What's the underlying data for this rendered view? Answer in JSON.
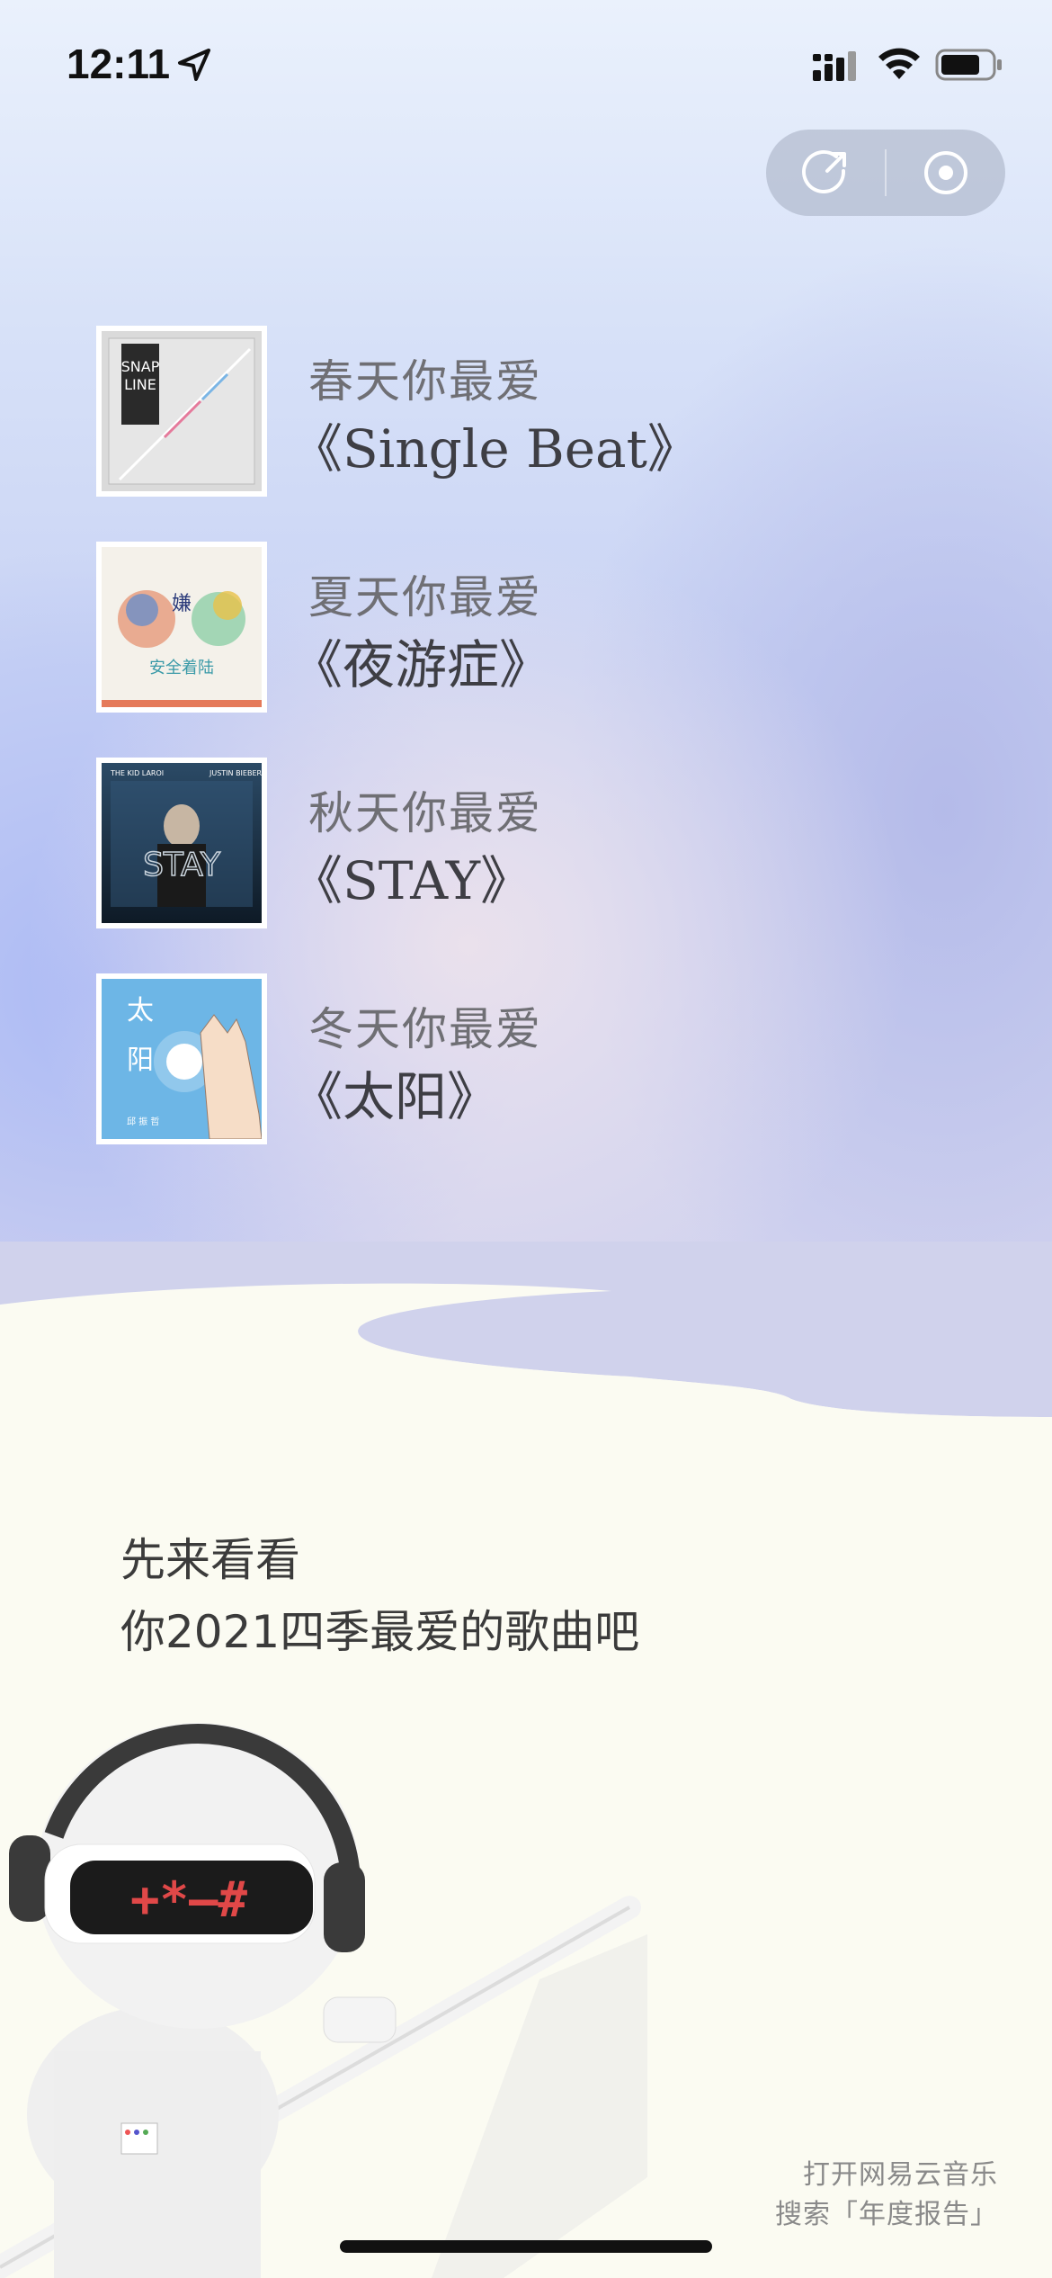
{
  "status_bar": {
    "time": "12:11"
  },
  "songs": [
    {
      "season": "春天你最爱",
      "title": "《Single Beat》",
      "cover": "snap-line-album-cover"
    },
    {
      "season": "夏天你最爱",
      "title": "《夜游症》",
      "cover": "anquan-album-cover"
    },
    {
      "season": "秋天你最爱",
      "title": "《STAY》",
      "cover": "stay-album-cover"
    },
    {
      "season": "冬天你最爱",
      "title": "《太阳》",
      "cover": "taiyang-album-cover"
    }
  ],
  "intro": {
    "line1": "先来看看",
    "line2": "你2021四季最爱的歌曲吧"
  },
  "footer": {
    "line1": "打开网易云音乐",
    "line2": "搜索「年度报告」"
  },
  "colors": {
    "accent_blue": "#aab9f5",
    "cream": "#fbfbf2",
    "wave": "#c6c8ea"
  },
  "icons": [
    "location-arrow-icon",
    "signal-icon",
    "wifi-icon",
    "battery-icon",
    "share-icon",
    "close-target-icon",
    "robot-mascot"
  ]
}
